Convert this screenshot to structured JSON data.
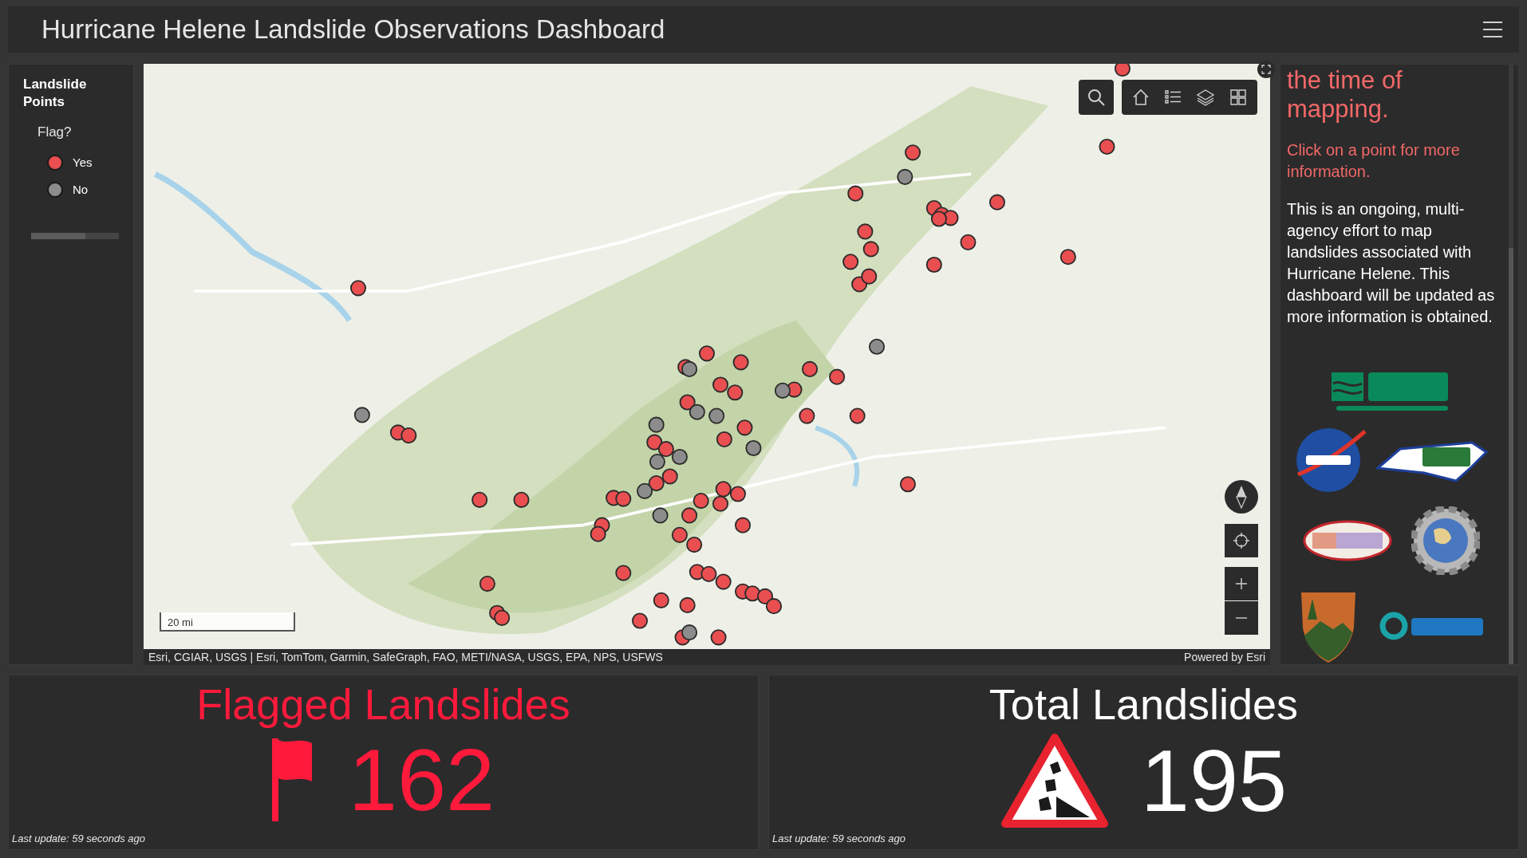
{
  "header": {
    "title": "Hurricane Helene Landslide Observations Dashboard"
  },
  "legend": {
    "title": "Landslide Points",
    "field": "Flag?",
    "items": [
      {
        "label": "Yes",
        "color": "#e94f50"
      },
      {
        "label": "No",
        "color": "#8c8c8c"
      }
    ]
  },
  "map": {
    "scale_label": "20 mi",
    "attribution": "Esri, CGIAR, USGS | Esri, TomTom, Garmin, SafeGraph, FAO, METI/NASA, USGS, EPA, NPS, USFWS",
    "powered_by": "Powered by Esri"
  },
  "info_panel": {
    "paragraphs": [
      {
        "kind": "lead",
        "text": "the time of mapping."
      },
      {
        "kind": "note",
        "text": "Click on a point for more information."
      },
      {
        "kind": "body",
        "text": "This is an ongoing, multi-agency effort to map landslides associated with Hurricane Helene.  This dashboard will be updated as more information is obtained."
      }
    ]
  },
  "indicators": [
    {
      "kind": "flag",
      "title": "Flagged Landslides",
      "value": "162",
      "color": "#ff1a3c",
      "footer": "Last update: 59 seconds ago"
    },
    {
      "kind": "warning",
      "title": "Total Landslides",
      "value": "195",
      "color": "#ffffff",
      "footer": "Last update: 59 seconds ago"
    }
  ]
}
